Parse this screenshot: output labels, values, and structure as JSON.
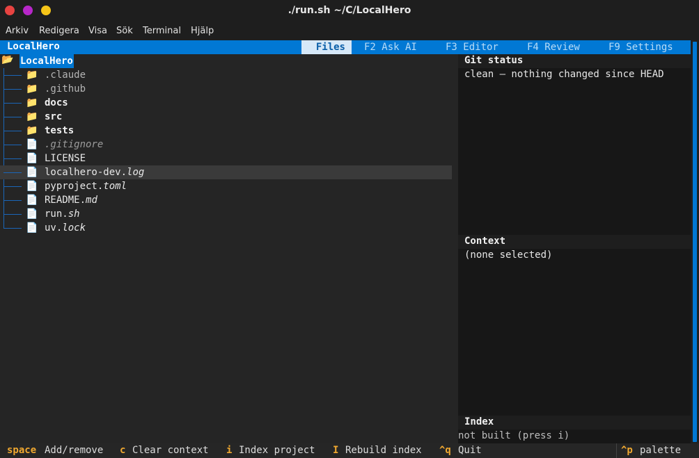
{
  "window": {
    "title": "./run.sh ~/C/LocalHero",
    "colors": {
      "close": "#e74341",
      "minimize": "#b727c9",
      "maximize": "#f5c518"
    }
  },
  "menu": [
    "Arkiv",
    "Redigera",
    "Visa",
    "Sök",
    "Terminal",
    "Hjälp"
  ],
  "app": {
    "name": "LocalHero",
    "accent": "#0178d4",
    "tabs": [
      "Files",
      "F2 Ask AI",
      "F3 Editor",
      "F4 Review",
      "F9 Settings"
    ],
    "active_tab": "Files"
  },
  "tree": {
    "root": "LocalHero",
    "items": [
      {
        "name": ".claude",
        "ext": "",
        "type": "folder",
        "style": "muted"
      },
      {
        "name": ".github",
        "ext": "",
        "type": "folder",
        "style": "muted"
      },
      {
        "name": "docs",
        "ext": "",
        "type": "folder",
        "style": "bold"
      },
      {
        "name": "src",
        "ext": "",
        "type": "folder",
        "style": "bold"
      },
      {
        "name": "tests",
        "ext": "",
        "type": "folder",
        "style": "bold"
      },
      {
        "name": "",
        "ext": ".gitignore",
        "type": "file",
        "style": "italic-muted"
      },
      {
        "name": "LICENSE",
        "ext": "",
        "type": "file",
        "style": "normal"
      },
      {
        "name": "localhero-dev.",
        "ext": "log",
        "type": "file",
        "style": "normal",
        "selected": true
      },
      {
        "name": "pyproject.",
        "ext": "toml",
        "type": "file",
        "style": "normal"
      },
      {
        "name": "README.",
        "ext": "md",
        "type": "file",
        "style": "normal"
      },
      {
        "name": "run.",
        "ext": "sh",
        "type": "file",
        "style": "normal"
      },
      {
        "name": "uv.",
        "ext": "lock",
        "type": "file",
        "style": "normal"
      }
    ]
  },
  "git_status": {
    "title": "Git status",
    "text": "clean — nothing changed since HEAD"
  },
  "context": {
    "title": "Context",
    "text": "(none selected)"
  },
  "index": {
    "title": "Index",
    "text": "not built  (press i)"
  },
  "footer": [
    {
      "key": "space",
      "label": "Add/remove"
    },
    {
      "key": "c",
      "label": "Clear context"
    },
    {
      "key": "i",
      "label": "Index project"
    },
    {
      "key": "I",
      "label": "Rebuild index"
    },
    {
      "key": "^q",
      "label": "Quit"
    },
    {
      "key": "^p",
      "label": "palette"
    }
  ]
}
